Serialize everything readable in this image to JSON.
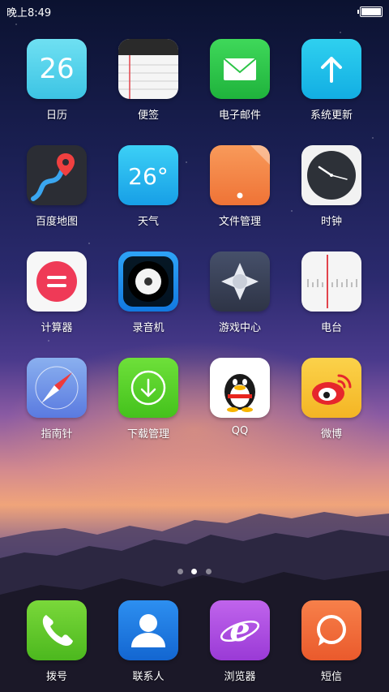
{
  "status_bar": {
    "time": "晚上8:49",
    "battery_level": 1.0
  },
  "apps": [
    {
      "id": "calendar",
      "label": "日历",
      "icon": "calendar-icon",
      "icon_text": "26"
    },
    {
      "id": "notes",
      "label": "便签",
      "icon": "notes-icon"
    },
    {
      "id": "email",
      "label": "电子邮件",
      "icon": "mail-icon"
    },
    {
      "id": "update",
      "label": "系统更新",
      "icon": "arrow-up-icon"
    },
    {
      "id": "maps",
      "label": "百度地图",
      "icon": "map-pin-icon"
    },
    {
      "id": "weather",
      "label": "天气",
      "icon": "weather-icon",
      "icon_text": "26°"
    },
    {
      "id": "files",
      "label": "文件管理",
      "icon": "folder-icon"
    },
    {
      "id": "clock",
      "label": "时钟",
      "icon": "clock-icon"
    },
    {
      "id": "calculator",
      "label": "计算器",
      "icon": "equals-icon"
    },
    {
      "id": "recorder",
      "label": "录音机",
      "icon": "speaker-icon"
    },
    {
      "id": "gamecenter",
      "label": "游戏中心",
      "icon": "gamepad-icon"
    },
    {
      "id": "radio",
      "label": "电台",
      "icon": "radio-tuner-icon"
    },
    {
      "id": "compass",
      "label": "指南针",
      "icon": "compass-icon"
    },
    {
      "id": "downloads",
      "label": "下载管理",
      "icon": "download-icon"
    },
    {
      "id": "qq",
      "label": "QQ",
      "icon": "qq-penguin-icon"
    },
    {
      "id": "weibo",
      "label": "微博",
      "icon": "weibo-icon"
    }
  ],
  "page_indicator": {
    "pages": 3,
    "current": 2
  },
  "dock": [
    {
      "id": "phone",
      "label": "拨号",
      "icon": "phone-icon"
    },
    {
      "id": "contacts",
      "label": "联系人",
      "icon": "contact-icon"
    },
    {
      "id": "browser",
      "label": "浏览器",
      "icon": "browser-e-icon"
    },
    {
      "id": "sms",
      "label": "短信",
      "icon": "message-bubble-icon"
    }
  ],
  "colors": {
    "calendar": "#4fd1e8",
    "notes": "#f4f4f4",
    "email": "#2bc446",
    "update": "#1ec0e9",
    "maps": "#2b2d34",
    "weather": "#1fb6f0",
    "files": "#f4874a",
    "clock": "#f2f2f2",
    "calculator": "#f7f7f7",
    "recorder": "#1b8df0",
    "gamecenter": "#3a4258",
    "radio": "#f5f5f5",
    "compass": "#6a8ae6",
    "downloads": "#5cd12e",
    "qq": "#ffffff",
    "weibo": "#f7c233",
    "phone": "#58c523",
    "contacts": "#1f7fe0",
    "browser": "#b24fe0",
    "sms": "#f06a3c"
  }
}
